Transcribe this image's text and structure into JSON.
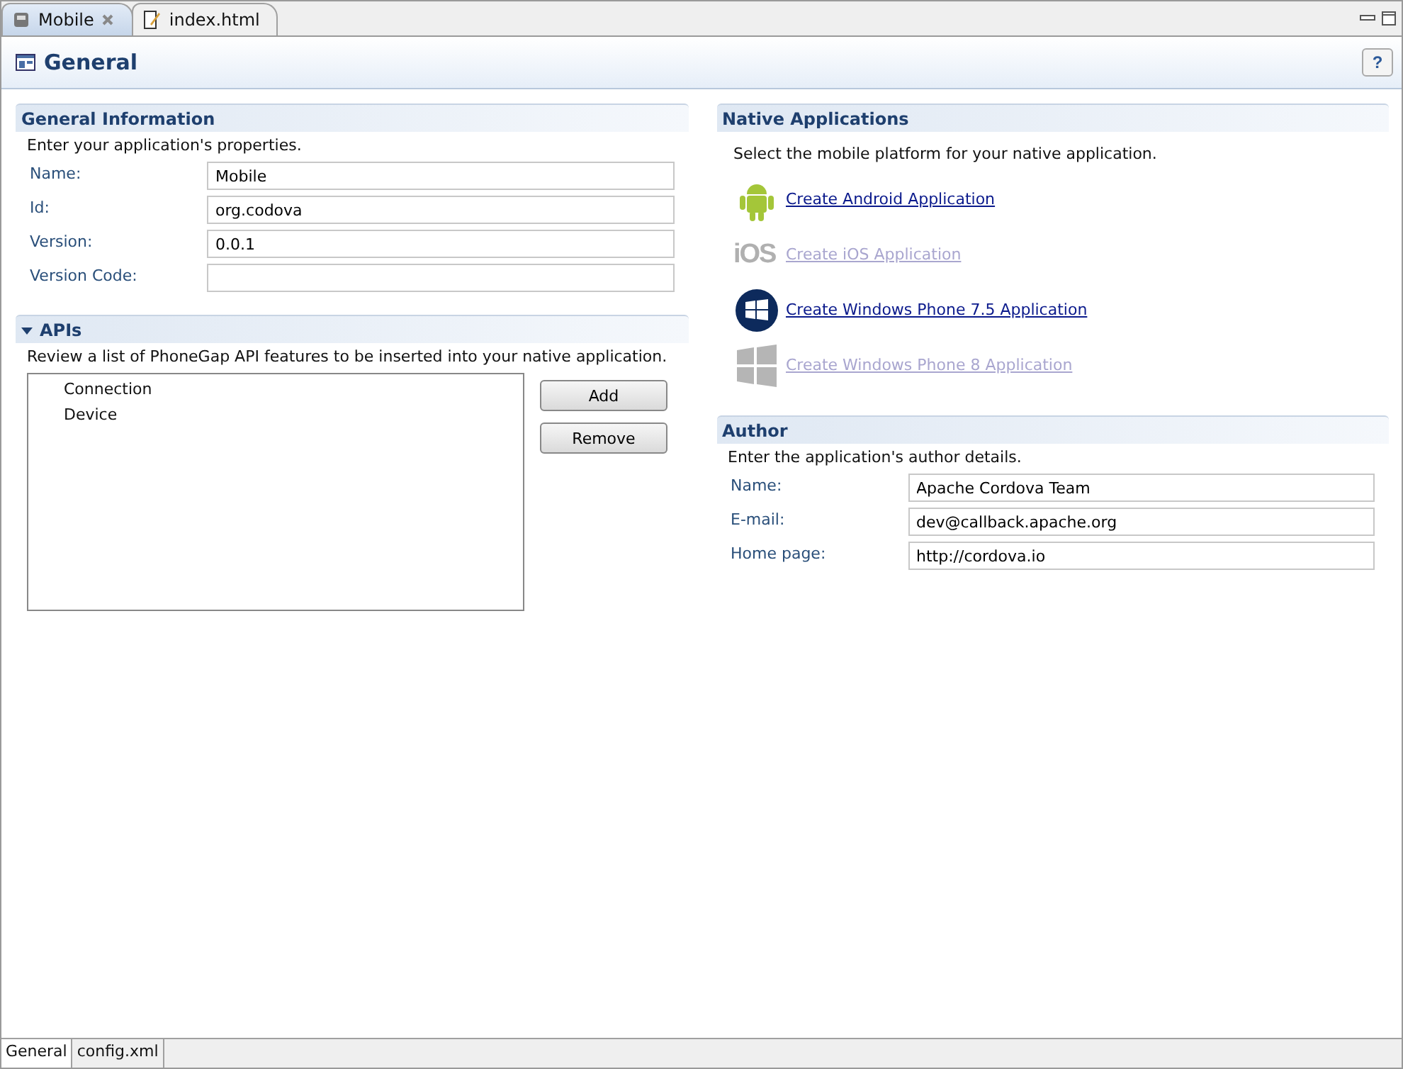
{
  "editor_tabs": [
    {
      "label": "Mobile",
      "kind": "config",
      "selected": true,
      "closable": true
    },
    {
      "label": "index.html",
      "kind": "html",
      "selected": false,
      "closable": false
    }
  ],
  "page": {
    "title": "General",
    "help": "?"
  },
  "general_information": {
    "title": "General Information",
    "description": "Enter your application's properties.",
    "fields": [
      {
        "label": "Name:",
        "value": "Mobile"
      },
      {
        "label": "Id:",
        "value": "org.codova"
      },
      {
        "label": "Version:",
        "value": "0.0.1"
      },
      {
        "label": "Version Code:"
      }
    ]
  },
  "apis": {
    "title": "APIs",
    "expanded": true,
    "description": "Review a list of PhoneGap API features to be inserted into your native application.",
    "items": [
      "Connection",
      "Device"
    ],
    "buttons": [
      "Add",
      "Remove"
    ]
  },
  "native_applications": {
    "title": "Native Applications",
    "description": "Select the mobile platform for your native application.",
    "platforms": [
      {
        "kind": "android",
        "label": "Create Android Application",
        "disabled": false
      },
      {
        "kind": "ios",
        "logo_text": "iOS",
        "label": "Create iOS Application",
        "disabled": true
      },
      {
        "kind": "winphone",
        "label": "Create Windows Phone 7.5 Application",
        "disabled": false
      },
      {
        "kind": "windows8",
        "label": "Create Windows Phone 8 Application",
        "disabled": true
      }
    ]
  },
  "author": {
    "title": "Author",
    "description": "Enter the application's author details.",
    "fields": [
      {
        "label": "Name:",
        "value": "Apache Cordova Team"
      },
      {
        "label": "E-mail:",
        "value": "dev@callback.apache.org"
      },
      {
        "label": "Home page:",
        "value": "http://cordova.io"
      }
    ]
  },
  "page_tabs": [
    {
      "label": "General",
      "selected": true
    },
    {
      "label": "config.xml",
      "selected": false
    }
  ]
}
